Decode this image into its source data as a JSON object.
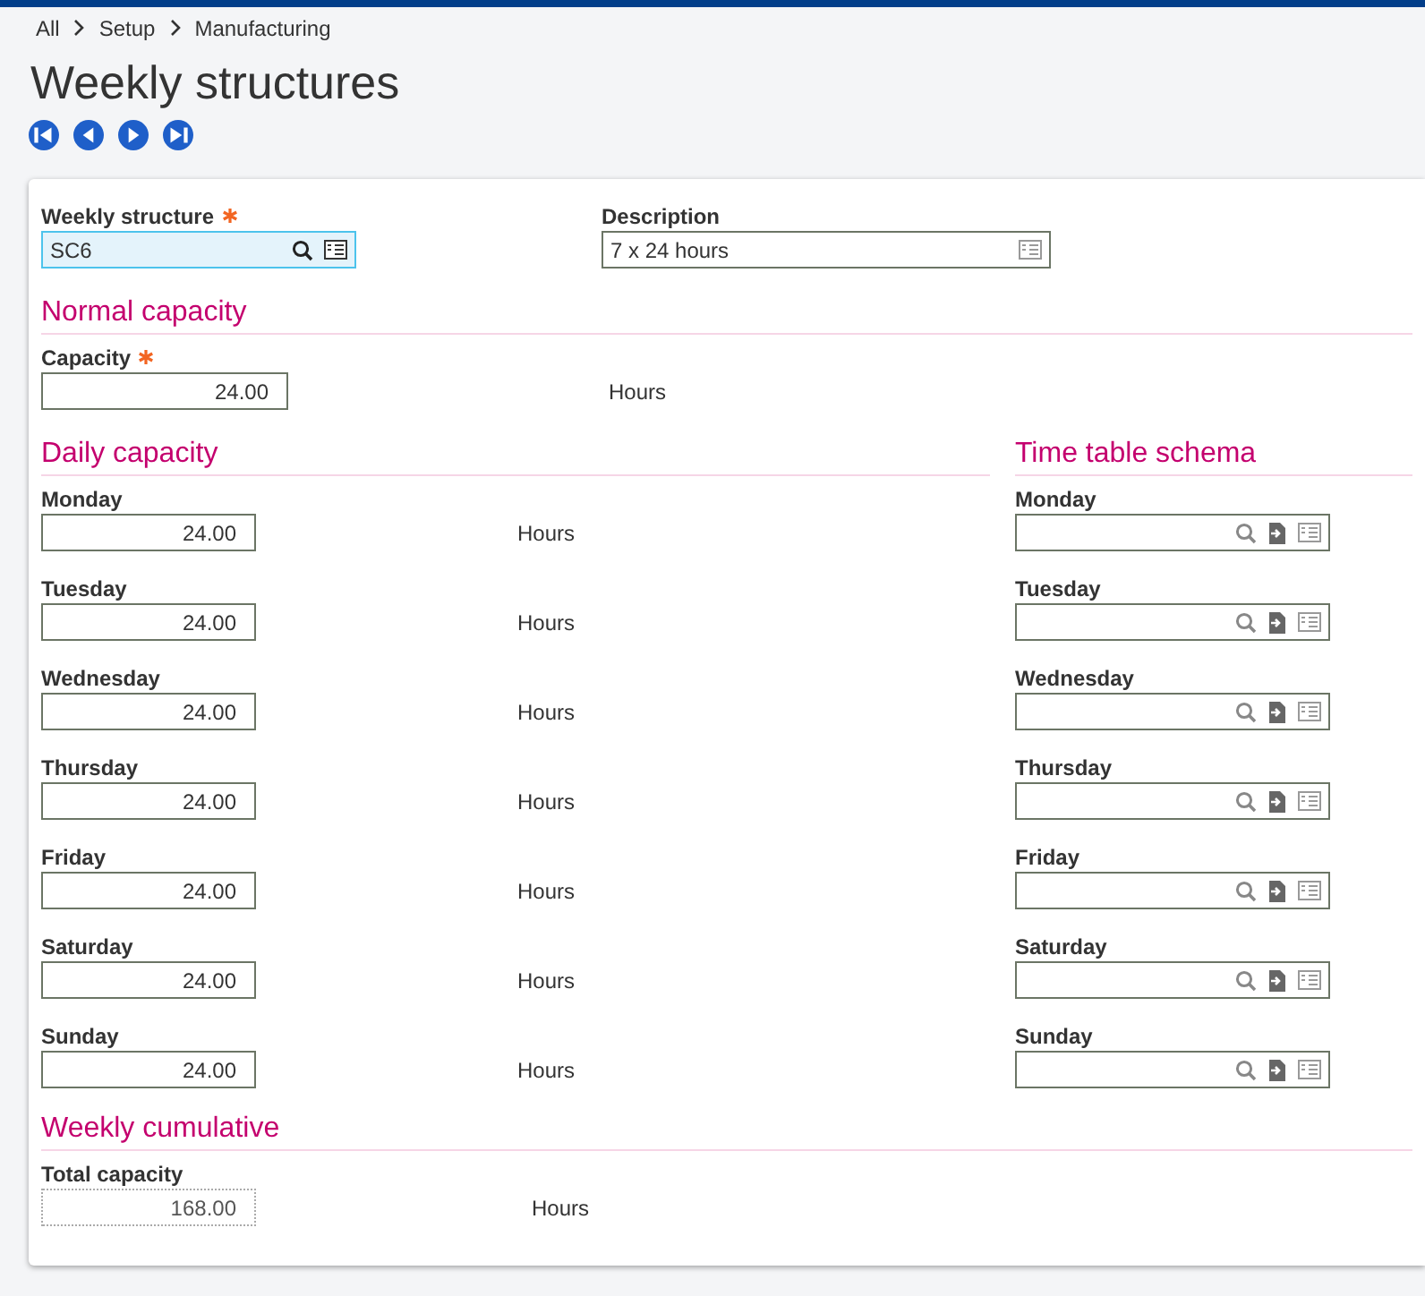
{
  "breadcrumb": [
    "All",
    "Setup",
    "Manufacturing"
  ],
  "title": "Weekly structures",
  "nav_buttons": [
    {
      "kind": "first"
    },
    {
      "kind": "previous"
    },
    {
      "kind": "next"
    },
    {
      "kind": "last"
    }
  ],
  "header": {
    "weekly_structure": {
      "label": "Weekly structure",
      "required": true,
      "value": "SC6",
      "focused": true,
      "kind": "lookup"
    },
    "description": {
      "label": "Description",
      "required": false,
      "value": "7 x 24 hours",
      "focused": false,
      "kind": "text"
    }
  },
  "normal_capacity": {
    "heading": "Normal capacity",
    "capacity": {
      "label": "Capacity",
      "required": true,
      "value": "24.00",
      "unit": "Hours",
      "kind": "number"
    }
  },
  "daily_capacity": {
    "heading": "Daily capacity",
    "rows": [
      {
        "label": "Monday",
        "value": "24.00",
        "unit": "Hours"
      },
      {
        "label": "Tuesday",
        "value": "24.00",
        "unit": "Hours"
      },
      {
        "label": "Wednesday",
        "value": "24.00",
        "unit": "Hours"
      },
      {
        "label": "Thursday",
        "value": "24.00",
        "unit": "Hours"
      },
      {
        "label": "Friday",
        "value": "24.00",
        "unit": "Hours"
      },
      {
        "label": "Saturday",
        "value": "24.00",
        "unit": "Hours"
      },
      {
        "label": "Sunday",
        "value": "24.00",
        "unit": "Hours"
      }
    ]
  },
  "time_table_schema": {
    "heading": "Time table schema",
    "rows": [
      {
        "label": "Monday"
      },
      {
        "label": "Tuesday"
      },
      {
        "label": "Wednesday"
      },
      {
        "label": "Thursday"
      },
      {
        "label": "Friday"
      },
      {
        "label": "Saturday"
      },
      {
        "label": "Sunday"
      }
    ]
  },
  "weekly_cumulative": {
    "heading": "Weekly cumulative",
    "total_capacity": {
      "label": "Total capacity",
      "value": "168.00",
      "unit": "Hours",
      "read_only": true
    }
  }
}
